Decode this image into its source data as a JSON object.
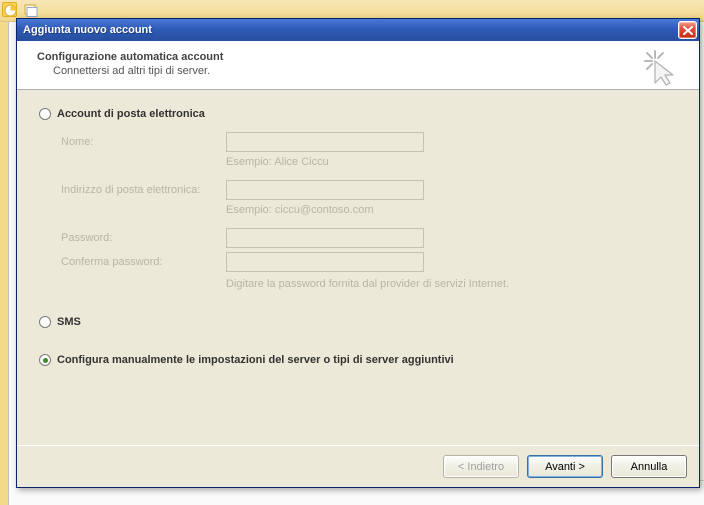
{
  "dialog": {
    "title": "Aggiunta nuovo account",
    "header_title": "Configurazione automatica account",
    "header_sub": "Connettersi ad altri tipi di server."
  },
  "options": {
    "email_label": "Account di posta elettronica",
    "sms_label": "SMS",
    "manual_label": "Configura manualmente le impostazioni del server o tipi di server aggiuntivi"
  },
  "form": {
    "name_label": "Nome:",
    "name_example": "Esempio: Alice Ciccu",
    "email_label": "Indirizzo di posta elettronica:",
    "email_example": "Esempio: ciccu@contoso.com",
    "password_label": "Password:",
    "confirm_label": "Conferma password:",
    "hint": "Digitare la password fornita dal provider di servizi Internet."
  },
  "buttons": {
    "back": "< Indietro",
    "next": "Avanti >",
    "cancel": "Annulla"
  }
}
